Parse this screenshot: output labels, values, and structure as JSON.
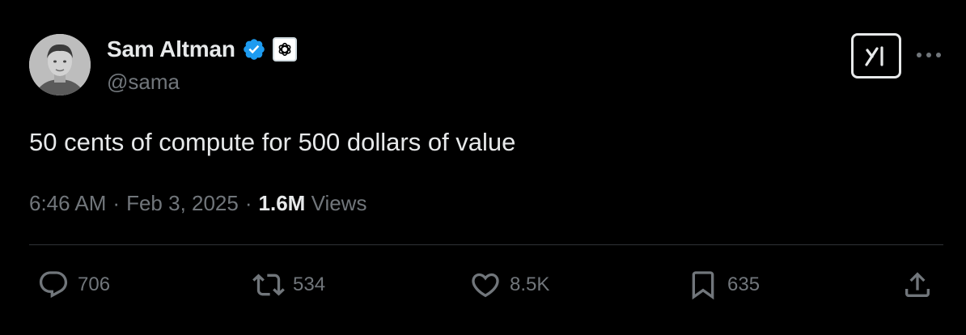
{
  "author": {
    "name": "Sam Altman",
    "handle": "@sama",
    "verified": true
  },
  "tweet": {
    "text": "50 cents of compute for 500 dollars of value"
  },
  "meta": {
    "time": "6:46 AM",
    "separator": "·",
    "date": "Feb 3, 2025",
    "views_count": "1.6M",
    "views_label": "Views"
  },
  "actions": {
    "replies": "706",
    "reposts": "534",
    "likes": "8.5K",
    "bookmarks": "635"
  },
  "icons": {
    "verified": "verified-badge-icon",
    "org": "openai-logo-icon",
    "grok": "grok-icon",
    "more": "more-icon",
    "reply": "reply-icon",
    "repost": "repost-icon",
    "like": "heart-icon",
    "bookmark": "bookmark-icon",
    "share": "share-icon"
  },
  "colors": {
    "background": "#000000",
    "text": "#e7e9ea",
    "secondary": "#71767b",
    "verified": "#1d9bf0",
    "divider": "#2f3336"
  }
}
